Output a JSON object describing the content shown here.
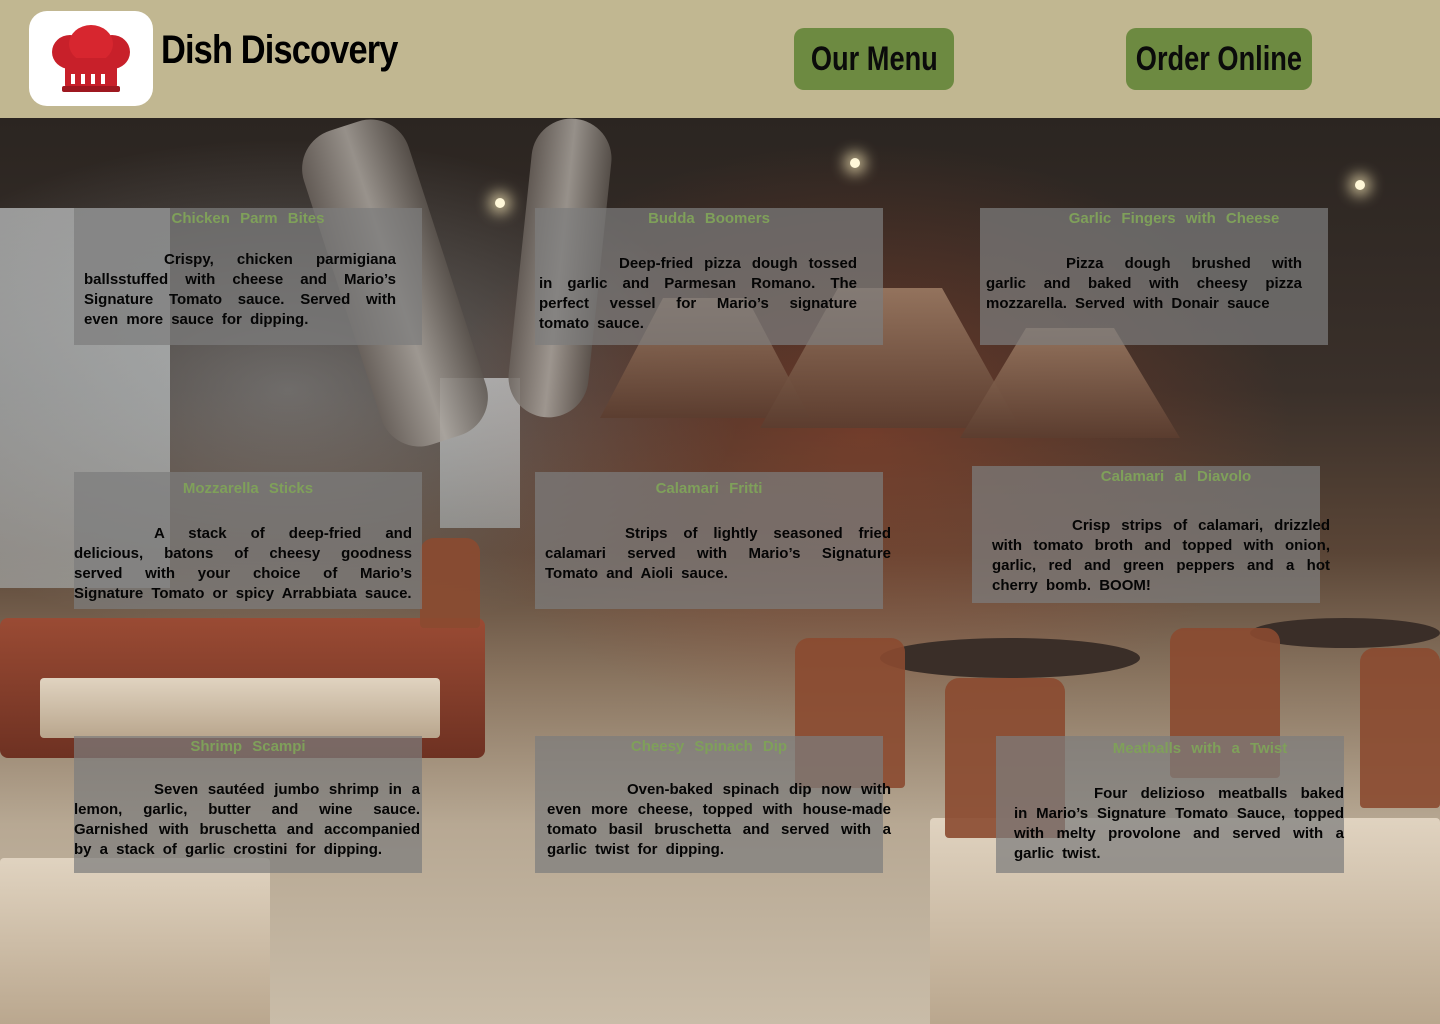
{
  "header": {
    "brand": "Dish Discovery",
    "logo_icon": "chef-hat-icon",
    "nav": [
      {
        "label": "Our Menu"
      },
      {
        "label": "Order Online"
      }
    ]
  },
  "colors": {
    "header_bg": "#c1b791",
    "button_bg": "#6d8a41",
    "card_title": "#7fa05a",
    "logo_red": "#c8202a"
  },
  "menu": [
    {
      "title": "Chicken Parm Bites",
      "desc": "Crispy, chicken parmigiana ballsstuffed with cheese and Mario’s Signature Tomato sauce. Served with even more sauce for dipping."
    },
    {
      "title": "Budda Boomers",
      "desc": "Deep-fried pizza dough tossed in garlic and Parmesan Romano. The perfect vessel for Mario’s signature tomato sauce."
    },
    {
      "title": "Garlic Fingers with Cheese",
      "desc": "Pizza dough brushed with garlic and baked with cheesy pizza mozzarella. Served with Donair sauce"
    },
    {
      "title": "Mozzarella Sticks",
      "desc": "A stack of deep-fried and delicious, batons of cheesy goodness served with your choice of Mario’s Signature Tomato or spicy Arrabbiata sauce."
    },
    {
      "title": "Calamari Fritti",
      "desc": "Strips of lightly seasoned fried calamari served with Mario’s Signature Tomato and Aioli sauce."
    },
    {
      "title": "Calamari al Diavolo",
      "desc": "Crisp strips of calamari, drizzled with tomato broth and topped with onion, garlic, red and green peppers and a hot cherry bomb. BOOM!"
    },
    {
      "title": "Shrimp Scampi",
      "desc": "Seven sautéed jumbo shrimp in a lemon, garlic, butter and wine sauce. Garnished with bruschetta and accompanied by a stack of garlic crostini for dipping."
    },
    {
      "title": "Cheesy Spinach Dip",
      "desc": "Oven-baked spinach dip now with even more cheese, topped with house-made tomato basil bruschetta and served with a garlic twist for dipping."
    },
    {
      "title": "Meatballs with a Twist",
      "desc": "Four delizioso meatballs baked in Mario’s Signature Tomato Sauce, topped with melty provolone and served with a garlic twist."
    }
  ]
}
